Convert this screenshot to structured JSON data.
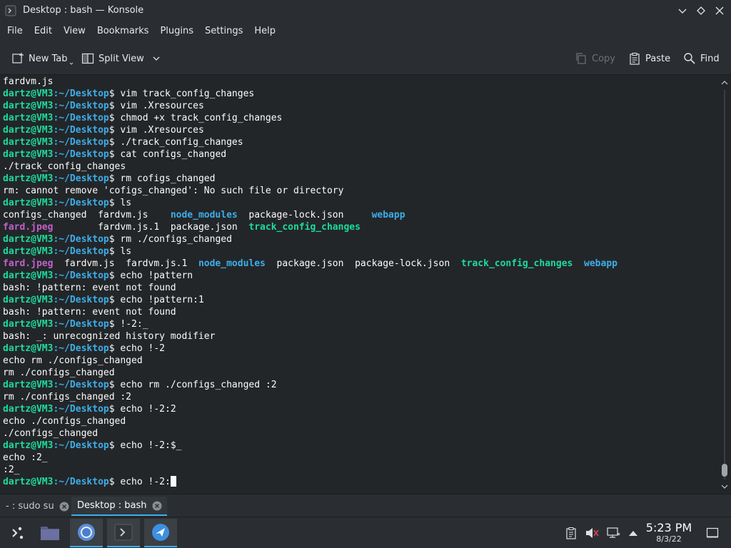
{
  "window": {
    "title": "Desktop : bash — Konsole",
    "icon": "konsole-icon",
    "controls": [
      "minimize-icon",
      "keep-above-icon",
      "close-icon"
    ]
  },
  "menubar": {
    "items": [
      "File",
      "Edit",
      "View",
      "Bookmarks",
      "Plugins",
      "Settings",
      "Help"
    ]
  },
  "toolbar": {
    "new_tab": "New Tab",
    "split_view": "Split View",
    "copy": "Copy",
    "paste": "Paste",
    "find": "Find"
  },
  "colors": {
    "background": "#232629",
    "prompt_user": "#1cdc9a",
    "prompt_path": "#3daee9",
    "executable": "#1cdc9a",
    "directory": "#3daee9",
    "image_file": "#c061cb",
    "accent": "#3daee9"
  },
  "prompt": {
    "user_host": "dartz@VM3",
    "path": "~/Desktop",
    "symbol": "$"
  },
  "terminal": {
    "lines": [
      {
        "type": "out",
        "segments": [
          {
            "t": "fardvm.js"
          }
        ]
      },
      {
        "type": "cmd",
        "cmd": "vim track_config_changes"
      },
      {
        "type": "cmd",
        "cmd": "vim .Xresources"
      },
      {
        "type": "cmd",
        "cmd": "chmod +x track_config_changes"
      },
      {
        "type": "cmd",
        "cmd": "vim .Xresources"
      },
      {
        "type": "cmd",
        "cmd": "./track_config_changes"
      },
      {
        "type": "cmd",
        "cmd": "cat configs_changed"
      },
      {
        "type": "out",
        "segments": [
          {
            "t": "./track_config_changes"
          }
        ]
      },
      {
        "type": "cmd",
        "cmd": "rm cofigs_changed"
      },
      {
        "type": "out",
        "segments": [
          {
            "t": "rm: cannot remove 'cofigs_changed': No such file or directory"
          }
        ]
      },
      {
        "type": "cmd",
        "cmd": "ls"
      },
      {
        "type": "out",
        "segments": [
          {
            "t": "configs_changed  "
          },
          {
            "t": "fardvm.js    "
          },
          {
            "t": "node_modules",
            "c": "dir"
          },
          {
            "t": "  package-lock.json     "
          },
          {
            "t": "webapp",
            "c": "dir"
          }
        ]
      },
      {
        "type": "out",
        "segments": [
          {
            "t": "fard.jpeg",
            "c": "img"
          },
          {
            "t": "        fardvm.js.1  package.json  "
          },
          {
            "t": "track_config_changes",
            "c": "exec"
          }
        ]
      },
      {
        "type": "cmd",
        "cmd": "rm ./configs_changed"
      },
      {
        "type": "cmd",
        "cmd": "ls"
      },
      {
        "type": "out",
        "segments": [
          {
            "t": "fard.jpeg",
            "c": "img"
          },
          {
            "t": "  fardvm.js  fardvm.js.1  "
          },
          {
            "t": "node_modules",
            "c": "dir"
          },
          {
            "t": "  package.json  package-lock.json  "
          },
          {
            "t": "track_config_changes",
            "c": "exec"
          },
          {
            "t": "  "
          },
          {
            "t": "webapp",
            "c": "dir"
          }
        ]
      },
      {
        "type": "cmd",
        "cmd": "echo !pattern"
      },
      {
        "type": "out",
        "segments": [
          {
            "t": "bash: !pattern: event not found"
          }
        ]
      },
      {
        "type": "cmd",
        "cmd": "echo !pattern:1"
      },
      {
        "type": "out",
        "segments": [
          {
            "t": "bash: !pattern: event not found"
          }
        ]
      },
      {
        "type": "cmd",
        "cmd": "!-2:_"
      },
      {
        "type": "out",
        "segments": [
          {
            "t": "bash: _: unrecognized history modifier"
          }
        ]
      },
      {
        "type": "cmd",
        "cmd": "echo !-2"
      },
      {
        "type": "out",
        "segments": [
          {
            "t": "echo rm ./configs_changed"
          }
        ]
      },
      {
        "type": "out",
        "segments": [
          {
            "t": "rm ./configs_changed"
          }
        ]
      },
      {
        "type": "cmd",
        "cmd": "echo rm ./configs_changed :2"
      },
      {
        "type": "out",
        "segments": [
          {
            "t": "rm ./configs_changed :2"
          }
        ]
      },
      {
        "type": "cmd",
        "cmd": "echo !-2:2"
      },
      {
        "type": "out",
        "segments": [
          {
            "t": "echo ./configs_changed"
          }
        ]
      },
      {
        "type": "out",
        "segments": [
          {
            "t": "./configs_changed"
          }
        ]
      },
      {
        "type": "cmd",
        "cmd": "echo !-2:$_"
      },
      {
        "type": "out",
        "segments": [
          {
            "t": "echo :2_"
          }
        ]
      },
      {
        "type": "out",
        "segments": [
          {
            "t": ":2_"
          }
        ]
      },
      {
        "type": "cmd",
        "cmd": "echo !-2:",
        "cursor": true
      }
    ]
  },
  "tabs": [
    {
      "label": "- : sudo su",
      "active": false
    },
    {
      "label": "Desktop : bash",
      "active": true
    }
  ],
  "panel": {
    "launchers": [
      "application-launcher-icon",
      "file-manager-icon",
      "chromium-icon",
      "konsole-icon",
      "remote-desktop-icon"
    ],
    "tray": [
      "clipboard-icon",
      "volume-muted-icon",
      "network-icon",
      "tray-expand-icon"
    ],
    "time": "5:23 PM",
    "date": "8/3/22"
  }
}
